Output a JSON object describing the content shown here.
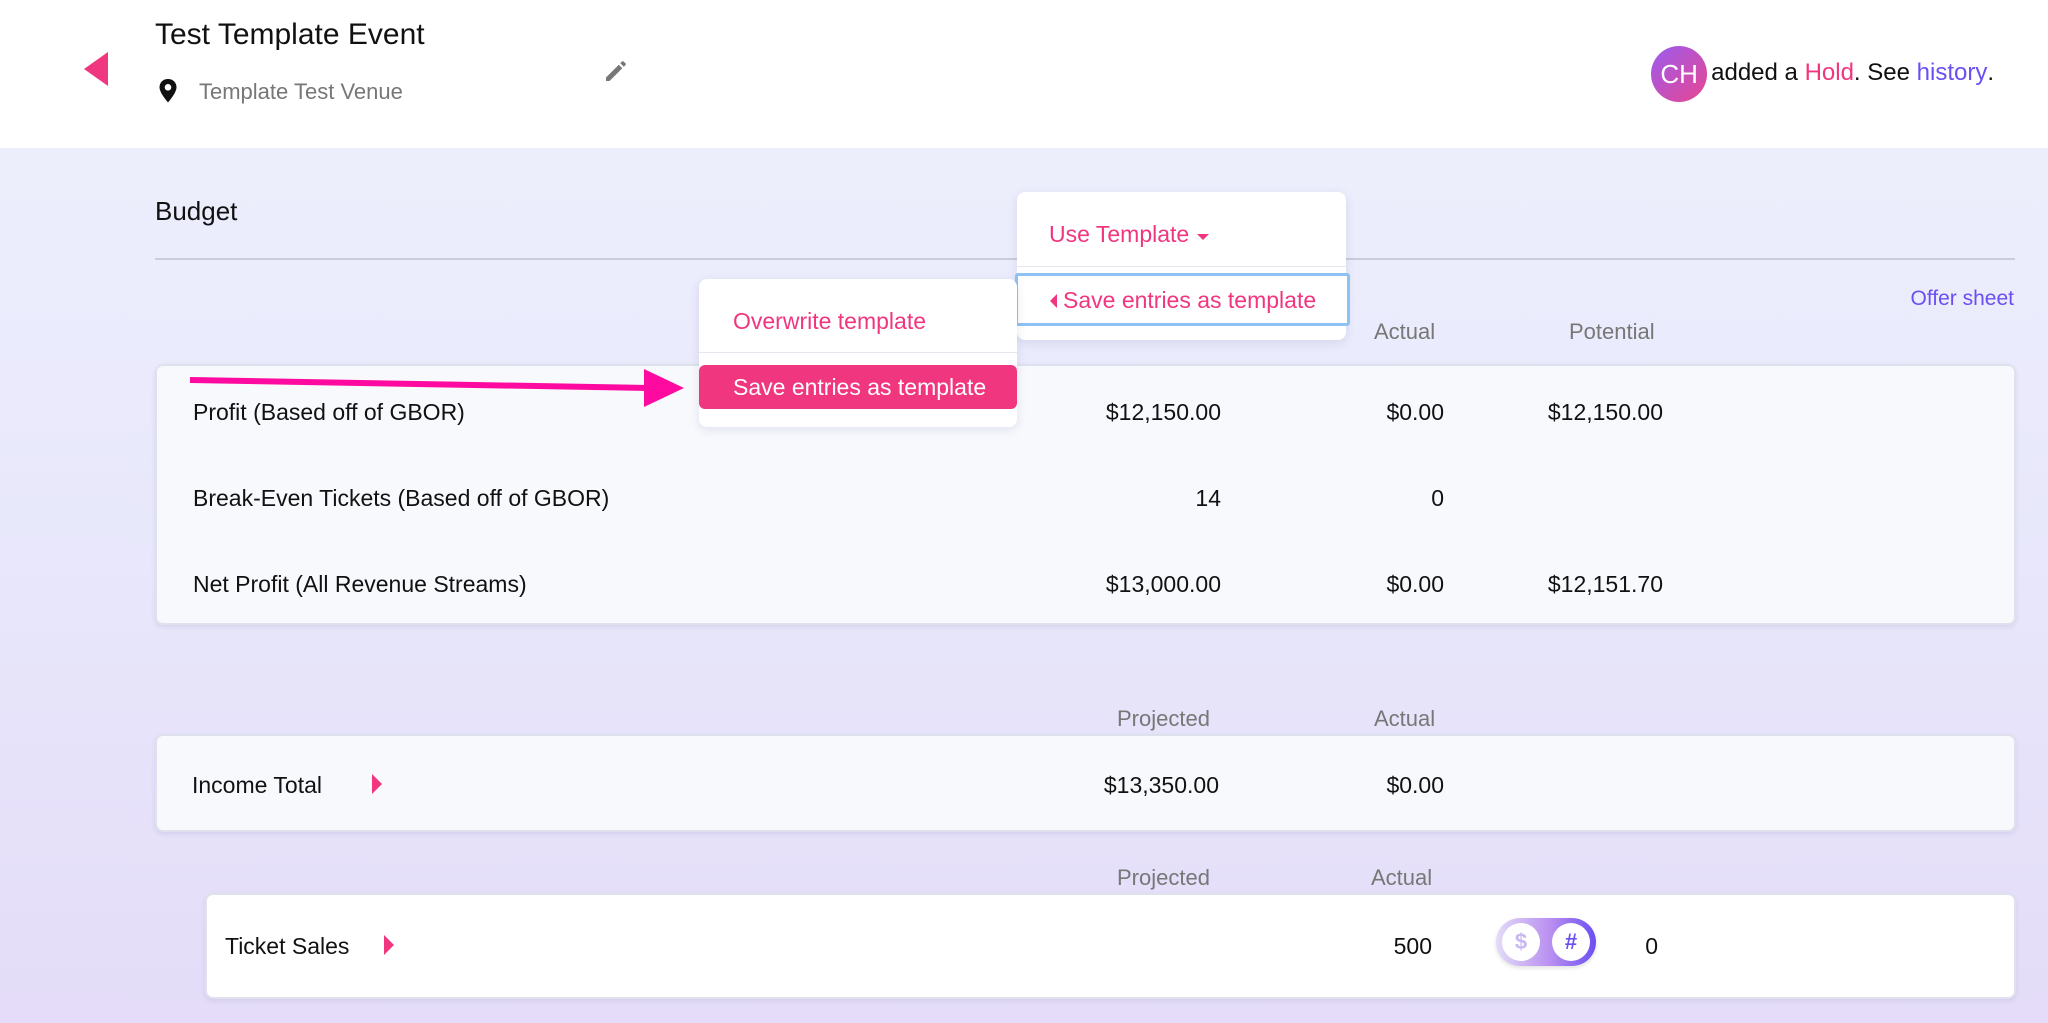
{
  "header": {
    "event_title": "Test Template Event",
    "venue": "Template Test Venue",
    "activity": {
      "avatar_initials": "CH",
      "text_prefix": "added a ",
      "hold_word": "Hold",
      "text_middle": ". See ",
      "history_link": "history",
      "text_suffix": "."
    }
  },
  "budget": {
    "title": "Budget",
    "offer_sheet_link": "Offer sheet",
    "summary": {
      "headers": {
        "actual": "Actual",
        "potential": "Potential"
      },
      "rows": [
        {
          "label": "Profit (Based off of GBOR)",
          "projected": "$12,150.00",
          "actual": "$0.00",
          "potential": "$12,150.00"
        },
        {
          "label": "Break-Even Tickets (Based off of GBOR)",
          "projected": "14",
          "actual": "0",
          "potential": ""
        },
        {
          "label": "Net Profit (All Revenue Streams)",
          "projected": "$13,000.00",
          "actual": "$0.00",
          "potential": "$12,151.70"
        }
      ]
    },
    "income": {
      "headers": {
        "projected": "Projected",
        "actual": "Actual"
      },
      "label": "Income Total",
      "projected": "$13,350.00",
      "actual": "$0.00"
    },
    "ticket_sales": {
      "headers": {
        "projected": "Projected",
        "actual": "Actual"
      },
      "label": "Ticket Sales",
      "projected": "500",
      "actual": "0",
      "toggle": {
        "dollar": "$",
        "hash": "#",
        "selected": "#"
      }
    }
  },
  "template_menu": {
    "use_template": "Use Template",
    "save_entries": "Save entries as template",
    "submenu": {
      "overwrite": "Overwrite template",
      "save_entries": "Save entries as template"
    }
  },
  "colors": {
    "accent_pink": "#f0367f",
    "link_purple": "#6c4ff2",
    "focus_blue": "#8ec1f4"
  }
}
